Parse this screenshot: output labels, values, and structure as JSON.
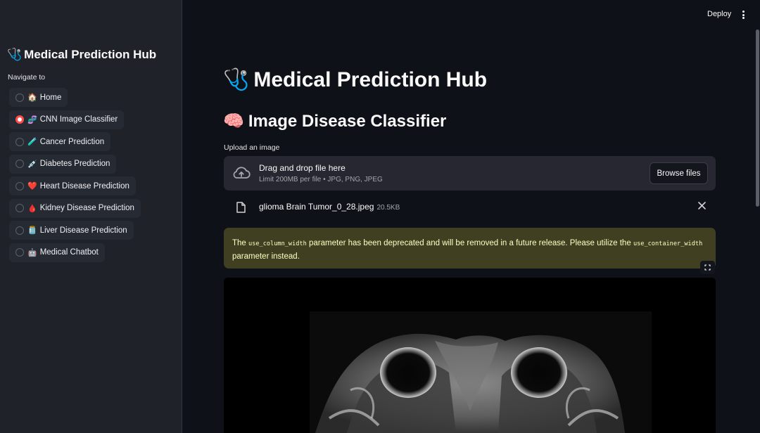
{
  "sidebar": {
    "title": "Medical Prediction Hub",
    "title_emoji": "🩺",
    "nav_label": "Navigate to",
    "items": [
      {
        "emoji": "🏠",
        "label": "Home",
        "selected": false
      },
      {
        "emoji": "🧬",
        "label": "CNN Image Classifier",
        "selected": true
      },
      {
        "emoji": "🧪",
        "label": "Cancer Prediction",
        "selected": false
      },
      {
        "emoji": "💉",
        "label": "Diabetes Prediction",
        "selected": false
      },
      {
        "emoji": "❤️",
        "label": "Heart Disease Prediction",
        "selected": false
      },
      {
        "emoji": "🩸",
        "label": "Kidney Disease Prediction",
        "selected": false
      },
      {
        "emoji": "🫙",
        "label": "Liver Disease Prediction",
        "selected": false
      },
      {
        "emoji": "🤖",
        "label": "Medical Chatbot",
        "selected": false
      }
    ]
  },
  "header": {
    "deploy_label": "Deploy"
  },
  "main": {
    "title": "Medical Prediction Hub",
    "title_emoji": "🩺",
    "subtitle": "Image Disease Classifier",
    "subtitle_emoji": "🧠",
    "upload_label": "Upload an image",
    "dropzone": {
      "main_text": "Drag and drop file here",
      "sub_text": "Limit 200MB per file • JPG, PNG, JPEG",
      "browse_label": "Browse files"
    },
    "file": {
      "name": "glioma Brain Tumor_0_28.jpeg",
      "size": "20.5KB"
    },
    "warning": {
      "part1": "The ",
      "code1": "use_column_width",
      "part2": " parameter has been deprecated and will be removed in a future release. Please utilize the ",
      "code2": "use_container_width",
      "part3": " parameter instead."
    }
  },
  "colors": {
    "background": "#0e1117",
    "sidebar": "#1f2229",
    "accent_red": "#ff4b4b",
    "warning_bg": "#403f22",
    "warning_text": "#ffffc2"
  }
}
